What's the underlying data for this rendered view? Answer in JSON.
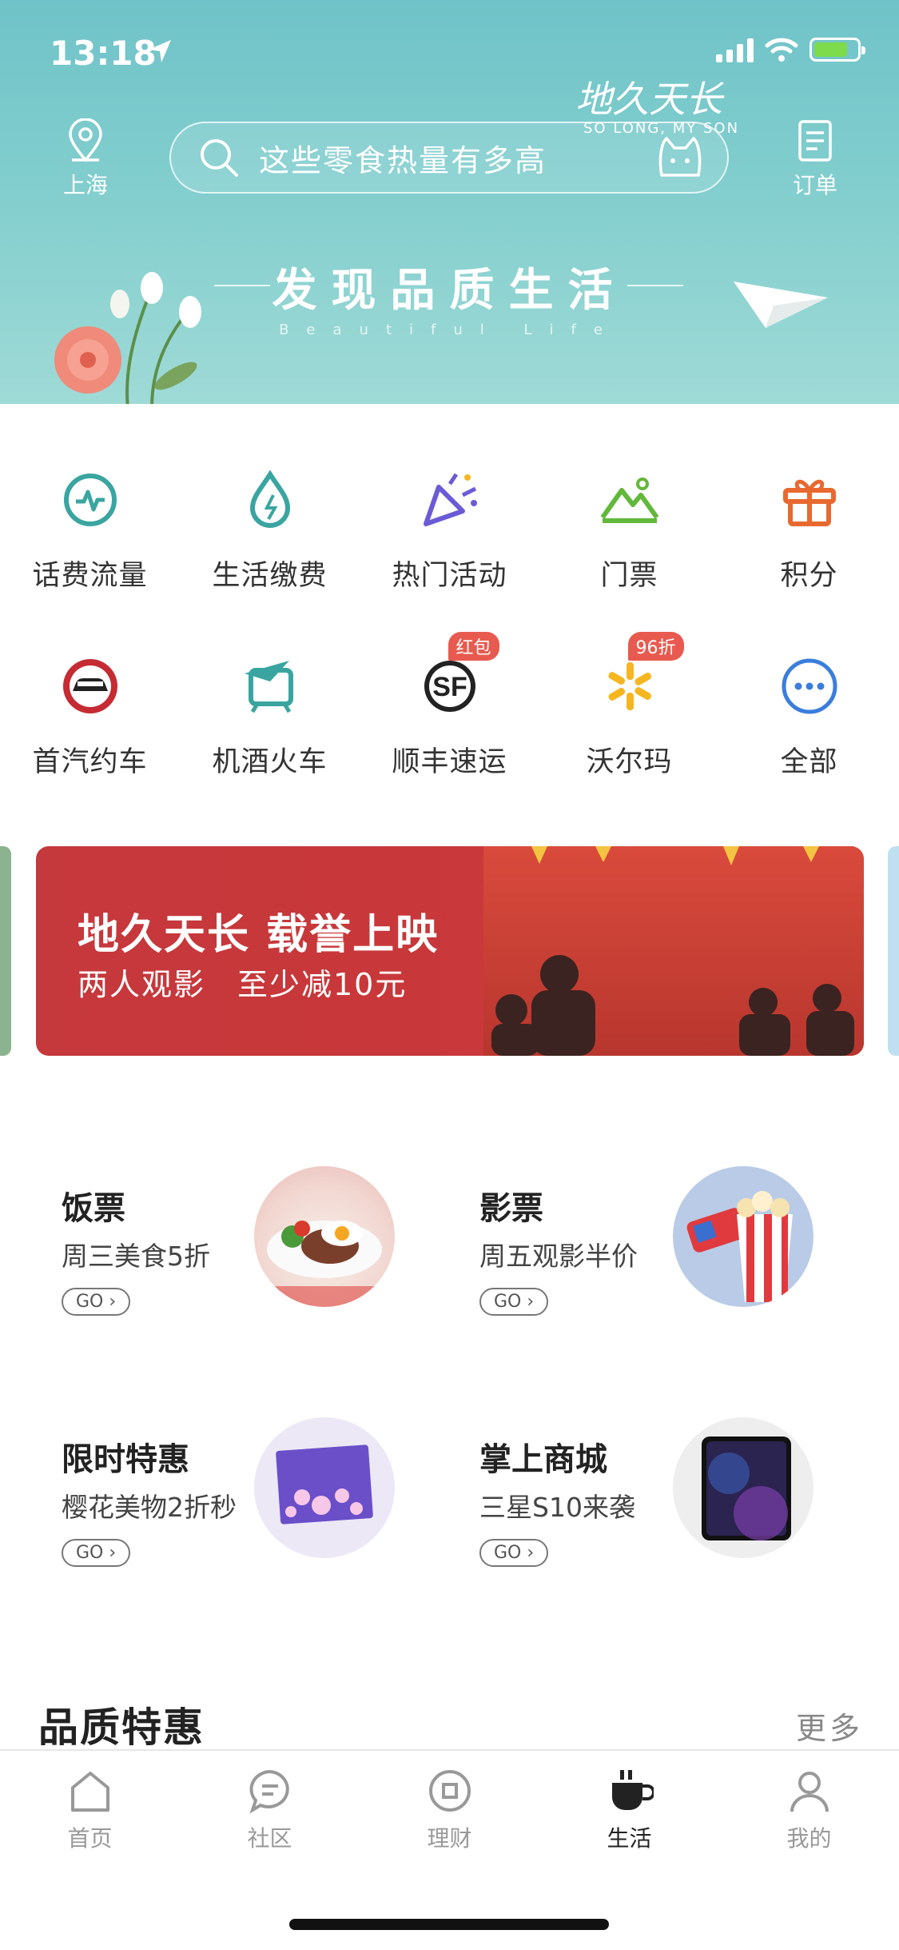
{
  "status": {
    "time": "13:18"
  },
  "header": {
    "location": "上海",
    "search_placeholder": "这些零食热量有多高",
    "orders": "订单",
    "slogan": "发现品质生活",
    "slogan_sub": "Beautiful Life"
  },
  "services": [
    {
      "label": "话费流量",
      "icon": "pulse-icon",
      "color": "#3aa5a0"
    },
    {
      "label": "生活缴费",
      "icon": "water-drop-icon",
      "color": "#3aa5a0"
    },
    {
      "label": "热门活动",
      "icon": "party-popper-icon",
      "color": "#6b5bd6"
    },
    {
      "label": "门票",
      "icon": "mountain-icon",
      "color": "#62b83a"
    },
    {
      "label": "积分",
      "icon": "gift-icon",
      "color": "#e8692f"
    },
    {
      "label": "首汽约车",
      "icon": "car-icon",
      "color": "#c62b33"
    },
    {
      "label": "机酒火车",
      "icon": "plane-train-icon",
      "color": "#3aa5a0"
    },
    {
      "label": "顺丰速运",
      "icon": "sf-logo-icon",
      "color": "#222222",
      "badge": "红包"
    },
    {
      "label": "沃尔玛",
      "icon": "walmart-spark-icon",
      "color": "#f5b621",
      "badge": "96折"
    },
    {
      "label": "全部",
      "icon": "more-dots-icon",
      "color": "#3b7ddd"
    }
  ],
  "banner": {
    "title": "地久天长 载誉上映",
    "subtitle": "两人观影　至少减10元",
    "poster_title": "地久天长",
    "poster_sub": "SO LONG, MY SON"
  },
  "promos": [
    {
      "title": "饭票",
      "subtitle": "周三美食5折",
      "go": "GO"
    },
    {
      "title": "影票",
      "subtitle": "周五观影半价",
      "go": "GO"
    },
    {
      "title": "限时特惠",
      "subtitle": "樱花美物2折秒",
      "go": "GO"
    },
    {
      "title": "掌上商城",
      "subtitle": "三星S10来袭",
      "go": "GO"
    }
  ],
  "section": {
    "title": "品质特惠",
    "more": "更多"
  },
  "tabs": [
    {
      "label": "首页",
      "icon": "home-icon"
    },
    {
      "label": "社区",
      "icon": "chat-icon"
    },
    {
      "label": "理财",
      "icon": "coin-icon"
    },
    {
      "label": "生活",
      "icon": "coffee-cup-icon",
      "active": true
    },
    {
      "label": "我的",
      "icon": "person-icon"
    }
  ],
  "colors": {
    "header": "#7ecac9",
    "banner": "#c5383c",
    "active_tab": "#222222",
    "inactive_tab": "#999999"
  }
}
